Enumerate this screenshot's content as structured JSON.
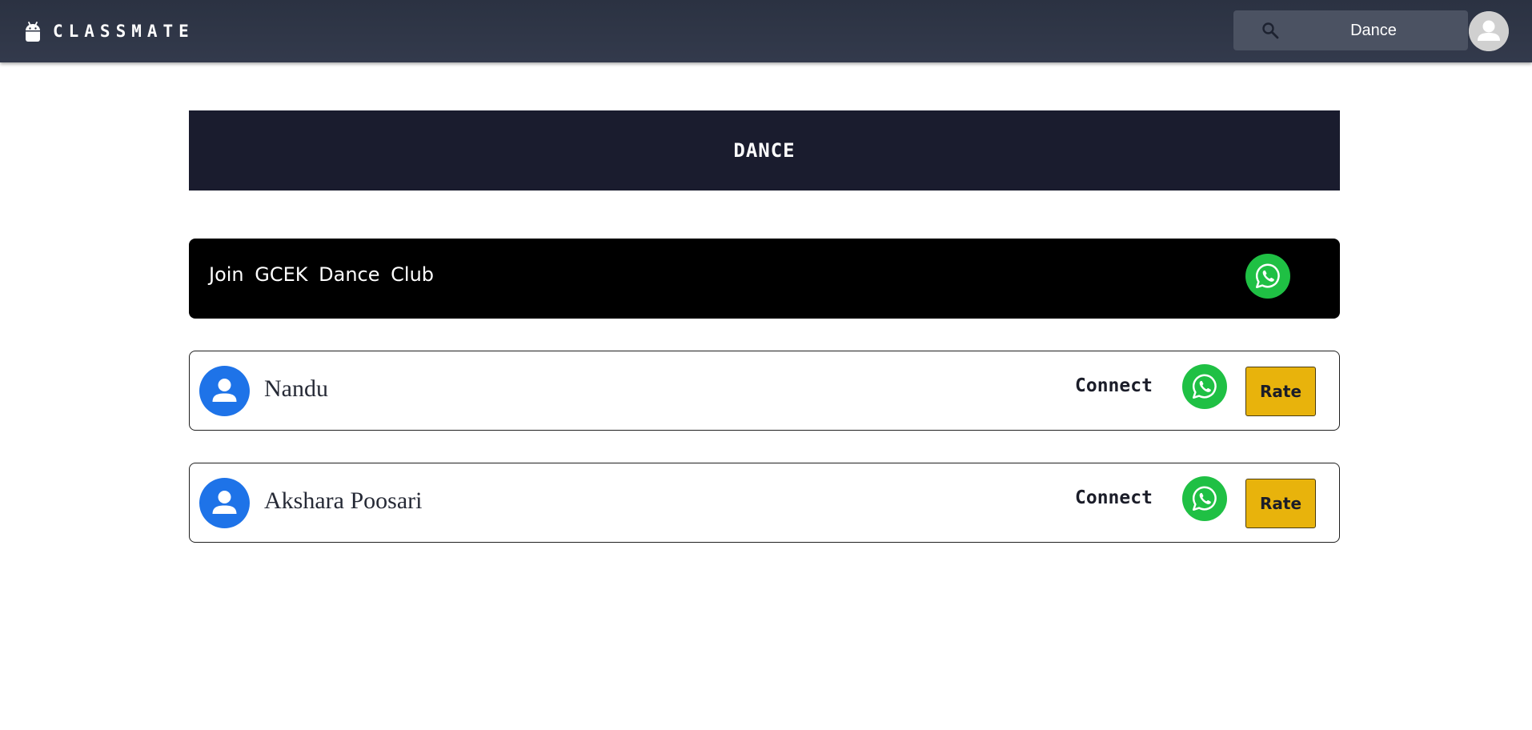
{
  "header": {
    "brand": "CLASSMATE",
    "search": {
      "value": "Dance"
    }
  },
  "page": {
    "title": "DANCE"
  },
  "club": {
    "text": "Join GCEK Dance Club"
  },
  "members": [
    {
      "name": "Nandu",
      "connect_label": "Connect",
      "rate_label": "Rate"
    },
    {
      "name": "Akshara Poosari",
      "connect_label": "Connect",
      "rate_label": "Rate"
    }
  ],
  "colors": {
    "topbar": "#2f3646",
    "title_bar": "#1a1c2e",
    "whatsapp": "#1fc044",
    "rate": "#e8b30c",
    "avatar": "#1e73e8"
  }
}
